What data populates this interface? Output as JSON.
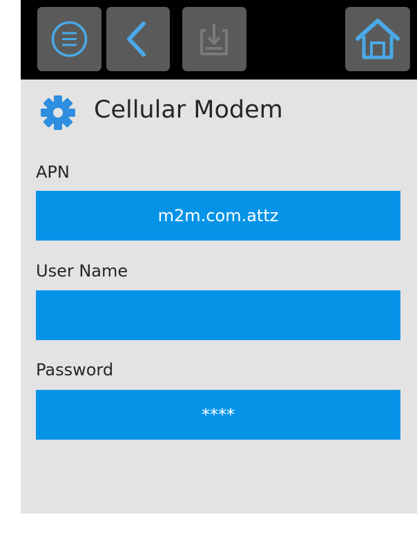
{
  "toolbar": {
    "buttons": [
      {
        "icon": "menu-icon",
        "enabled": true
      },
      {
        "icon": "back-icon",
        "enabled": true
      },
      {
        "icon": "save-icon",
        "enabled": false
      },
      {
        "icon": "home-icon",
        "enabled": true
      }
    ]
  },
  "page": {
    "title": "Cellular Modem",
    "title_icon": "gear-icon"
  },
  "fields": {
    "apn": {
      "label": "APN",
      "value": "m2m.com.attz"
    },
    "username": {
      "label": "User Name",
      "value": ""
    },
    "password": {
      "label": "Password",
      "value": "****"
    }
  },
  "colors": {
    "accent": "#0593e8",
    "icon_blue": "#4aa9e8",
    "toolbar_bg": "#000000",
    "button_bg": "#5a5a5a",
    "content_bg": "#e3e3e3",
    "text": "#262626"
  }
}
